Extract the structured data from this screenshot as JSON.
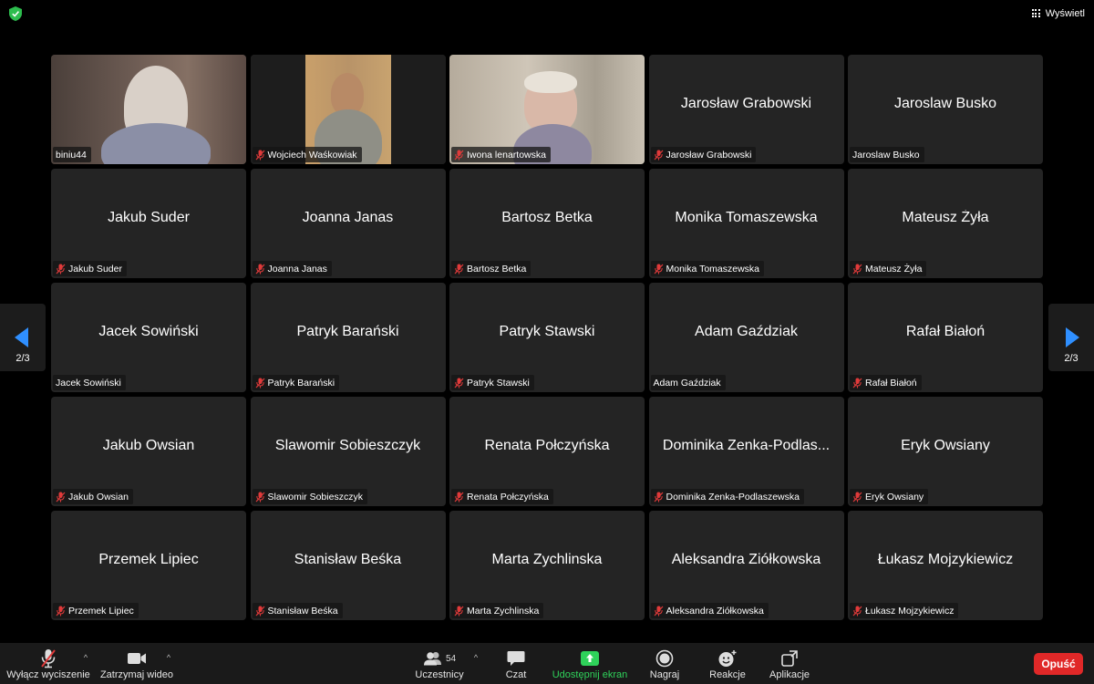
{
  "top_bar": {
    "security_icon": "shield-check-icon",
    "view_label": "Wyświetl"
  },
  "pagination": {
    "left_label": "2/3",
    "right_label": "2/3"
  },
  "tiles": [
    {
      "big_name": "",
      "label": "biniu44",
      "muted": false,
      "video": true
    },
    {
      "big_name": "",
      "label": "Wojciech Waśkowiak",
      "muted": true,
      "video": true
    },
    {
      "big_name": "",
      "label": "Iwona lenartowska",
      "muted": true,
      "video": true
    },
    {
      "big_name": "Jarosław Grabowski",
      "label": "Jarosław Grabowski",
      "muted": true,
      "video": false
    },
    {
      "big_name": "Jaroslaw Busko",
      "label": "Jaroslaw Busko",
      "muted": false,
      "video": false
    },
    {
      "big_name": "Jakub Suder",
      "label": "Jakub Suder",
      "muted": true,
      "video": false
    },
    {
      "big_name": "Joanna Janas",
      "label": "Joanna Janas",
      "muted": true,
      "video": false
    },
    {
      "big_name": "Bartosz Betka",
      "label": "Bartosz Betka",
      "muted": true,
      "video": false
    },
    {
      "big_name": "Monika Tomaszewska",
      "label": "Monika Tomaszewska",
      "muted": true,
      "video": false
    },
    {
      "big_name": "Mateusz Żyła",
      "label": "Mateusz Żyła",
      "muted": true,
      "video": false
    },
    {
      "big_name": "Jacek Sowiński",
      "label": "Jacek Sowiński",
      "muted": false,
      "video": false
    },
    {
      "big_name": "Patryk Barański",
      "label": "Patryk Barański",
      "muted": true,
      "video": false
    },
    {
      "big_name": "Patryk Stawski",
      "label": "Patryk Stawski",
      "muted": true,
      "video": false
    },
    {
      "big_name": "Adam Gaździak",
      "label": "Adam Gaździak",
      "muted": false,
      "video": false
    },
    {
      "big_name": "Rafał Białoń",
      "label": "Rafał Białoń",
      "muted": true,
      "video": false
    },
    {
      "big_name": "Jakub Owsian",
      "label": "Jakub Owsian",
      "muted": true,
      "video": false
    },
    {
      "big_name": "Slawomir Sobieszczyk",
      "label": "Slawomir Sobieszczyk",
      "muted": true,
      "video": false
    },
    {
      "big_name": "Renata Połczyńska",
      "label": "Renata Połczyńska",
      "muted": true,
      "video": false
    },
    {
      "big_name": "Dominika Zenka-Podlas...",
      "label": "Dominika Zenka-Podlaszewska",
      "muted": true,
      "video": false
    },
    {
      "big_name": "Eryk Owsiany",
      "label": "Eryk Owsiany",
      "muted": true,
      "video": false
    },
    {
      "big_name": "Przemek Lipiec",
      "label": "Przemek Lipiec",
      "muted": true,
      "video": false
    },
    {
      "big_name": "Stanisław Beśka",
      "label": "Stanisław Beśka",
      "muted": true,
      "video": false
    },
    {
      "big_name": "Marta Zychlinska",
      "label": "Marta Zychlinska",
      "muted": true,
      "video": false
    },
    {
      "big_name": "Aleksandra Ziółkowska",
      "label": "Aleksandra Ziółkowska",
      "muted": true,
      "video": false
    },
    {
      "big_name": "Łukasz Mojzykiewicz",
      "label": "Łukasz Mojzykiewicz",
      "muted": true,
      "video": false
    }
  ],
  "toolbar": {
    "unmute_label": "Wyłącz wyciszenie",
    "video_label": "Zatrzymaj wideo",
    "participants_label": "Uczestnicy",
    "participants_count": "54",
    "chat_label": "Czat",
    "share_label": "Udostępnij ekran",
    "record_label": "Nagraj",
    "reactions_label": "Reakcje",
    "apps_label": "Aplikacje",
    "leave_label": "Opuść"
  },
  "colors": {
    "tile_bg": "#242424",
    "accent_blue": "#2f8fff",
    "share_green": "#2fd25a",
    "leave_red": "#e02828",
    "mute_red": "#e03a3a"
  }
}
